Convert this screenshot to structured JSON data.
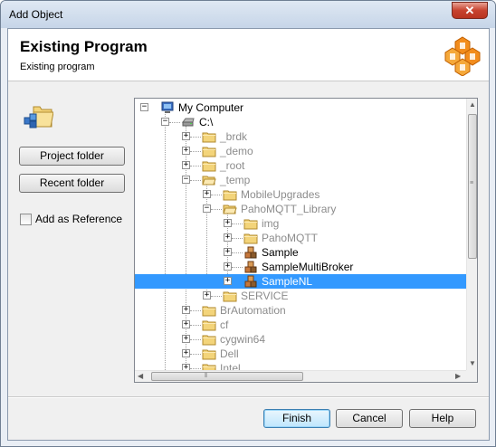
{
  "window": {
    "title": "Add Object",
    "close_label": "✕"
  },
  "header": {
    "title": "Existing Program",
    "subtitle": "Existing program"
  },
  "side": {
    "project_folder": "Project folder",
    "recent_folder": "Recent folder",
    "add_as_reference": "Add as Reference",
    "add_as_reference_checked": false
  },
  "tree": {
    "nodes": [
      {
        "label": "My Computer",
        "icon": "computer-icon",
        "expanded": true,
        "level": 0,
        "selected": false,
        "dim": false
      },
      {
        "label": "C:\\",
        "icon": "drive-icon",
        "expanded": true,
        "level": 1,
        "selected": false,
        "dim": false
      },
      {
        "label": "_brdk",
        "icon": "folder-icon",
        "expanded": false,
        "level": 2,
        "selected": false,
        "dim": true
      },
      {
        "label": "_demo",
        "icon": "folder-icon",
        "expanded": false,
        "level": 2,
        "selected": false,
        "dim": true
      },
      {
        "label": "_root",
        "icon": "folder-icon",
        "expanded": false,
        "level": 2,
        "selected": false,
        "dim": true
      },
      {
        "label": "_temp",
        "icon": "folder-open-icon",
        "expanded": true,
        "level": 2,
        "selected": false,
        "dim": true
      },
      {
        "label": "MobileUpgrades",
        "icon": "folder-icon",
        "expanded": false,
        "level": 3,
        "selected": false,
        "dim": true
      },
      {
        "label": "PahoMQTT_Library",
        "icon": "folder-open-icon",
        "expanded": true,
        "level": 3,
        "selected": false,
        "dim": true
      },
      {
        "label": "img",
        "icon": "folder-icon",
        "expanded": false,
        "level": 4,
        "selected": false,
        "dim": true
      },
      {
        "label": "PahoMQTT",
        "icon": "folder-icon",
        "expanded": false,
        "level": 4,
        "selected": false,
        "dim": true
      },
      {
        "label": "Sample",
        "icon": "program-icon",
        "expanded": false,
        "level": 4,
        "selected": false,
        "dim": false
      },
      {
        "label": "SampleMultiBroker",
        "icon": "program-icon",
        "expanded": false,
        "level": 4,
        "selected": false,
        "dim": false
      },
      {
        "label": "SampleNL",
        "icon": "program-icon",
        "expanded": false,
        "level": 4,
        "selected": true,
        "dim": false
      },
      {
        "label": "SERVICE",
        "icon": "folder-icon",
        "expanded": false,
        "level": 3,
        "selected": false,
        "dim": true
      },
      {
        "label": "BrAutomation",
        "icon": "folder-icon",
        "expanded": false,
        "level": 2,
        "selected": false,
        "dim": true
      },
      {
        "label": "cf",
        "icon": "folder-icon",
        "expanded": false,
        "level": 2,
        "selected": false,
        "dim": true
      },
      {
        "label": "cygwin64",
        "icon": "folder-icon",
        "expanded": false,
        "level": 2,
        "selected": false,
        "dim": true
      },
      {
        "label": "Dell",
        "icon": "folder-icon",
        "expanded": false,
        "level": 2,
        "selected": false,
        "dim": true
      },
      {
        "label": "Intel",
        "icon": "folder-icon",
        "expanded": false,
        "level": 2,
        "selected": false,
        "dim": true
      }
    ]
  },
  "buttons": {
    "finish": "Finish",
    "cancel": "Cancel",
    "help": "Help"
  },
  "colors": {
    "selection": "#3399ff",
    "folder": "#f3d47a",
    "dim_text": "#8c8c8c"
  }
}
